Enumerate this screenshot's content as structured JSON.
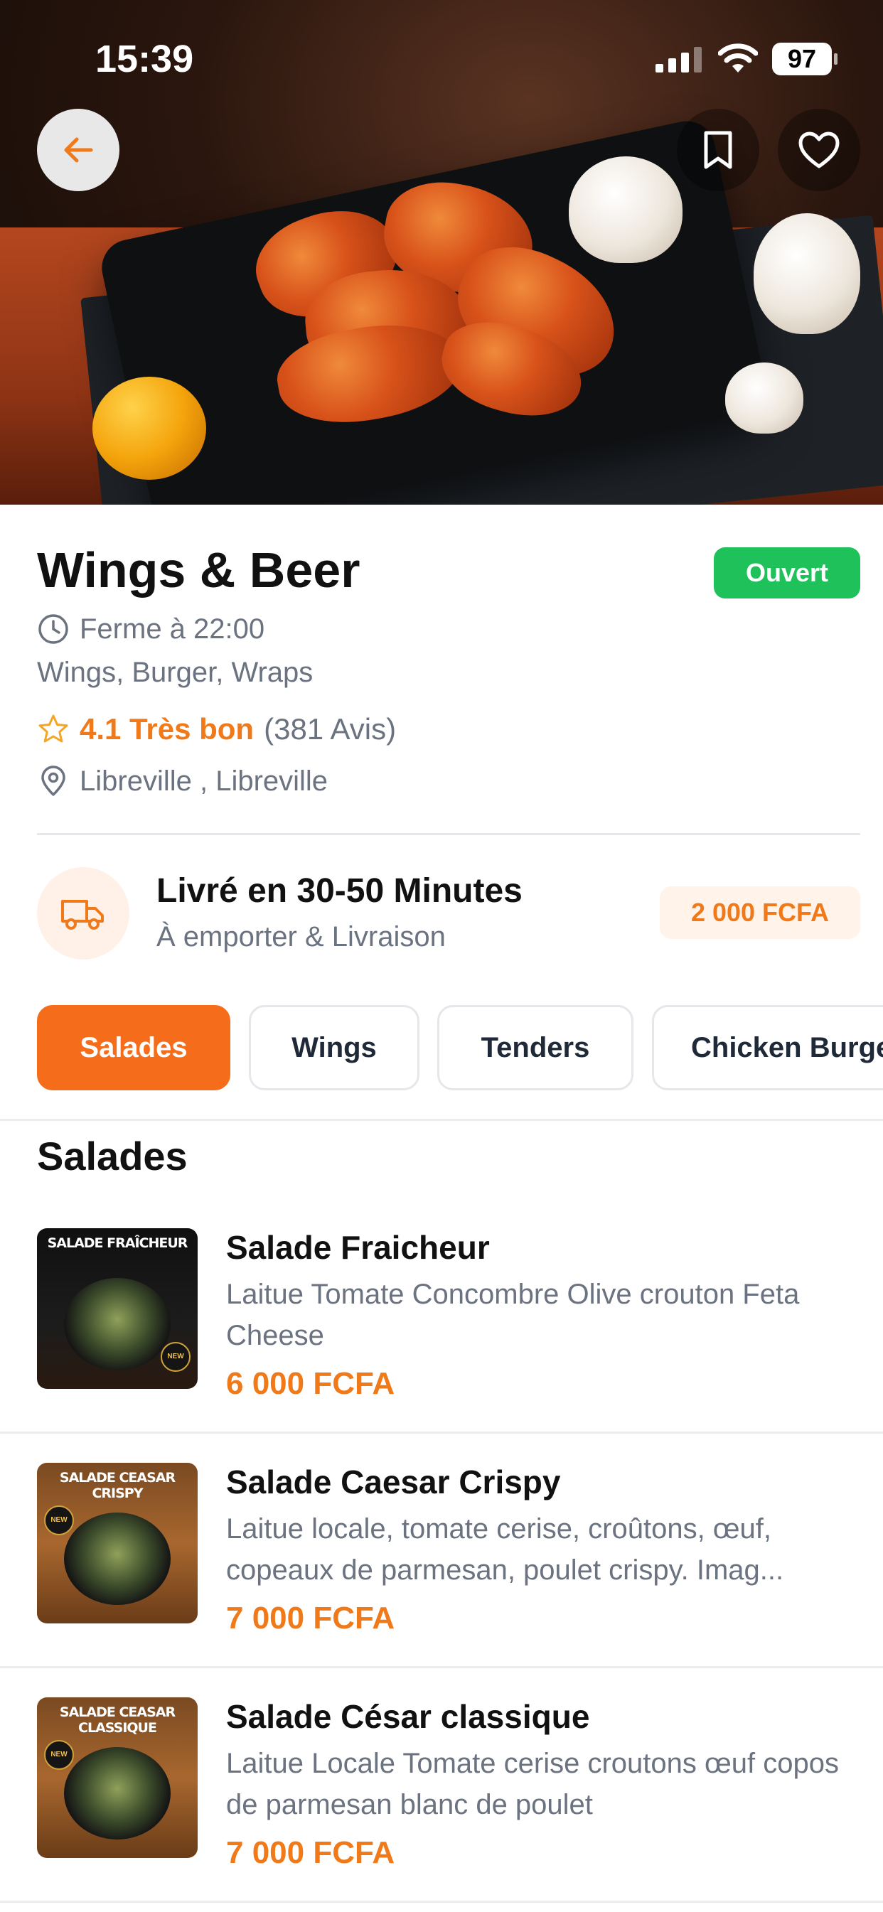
{
  "status_bar": {
    "time": "15:39",
    "battery": "97"
  },
  "restaurant": {
    "name": "Wings & Beer",
    "status": "Ouvert",
    "closing": "Ferme à 22:00",
    "cuisines": "Wings, Burger, Wraps",
    "rating": "4.1 Très bon",
    "reviews": "(381 Avis)",
    "location": "Libreville , Libreville"
  },
  "delivery": {
    "title": "Livré en 30-50 Minutes",
    "subtitle": "À emporter & Livraison",
    "fee": "2 000 FCFA"
  },
  "tabs": [
    {
      "label": "Salades"
    },
    {
      "label": "Wings"
    },
    {
      "label": "Tenders"
    },
    {
      "label": "Chicken Burgers"
    }
  ],
  "section": {
    "title": "Salades"
  },
  "items": [
    {
      "name": "Salade Fraicheur",
      "description": "Laitue Tomate Concombre Olive crouton Feta Cheese",
      "price": "6 000 FCFA",
      "thumb_label": "SALADE FRAÎCHEUR"
    },
    {
      "name": "Salade Caesar Crispy",
      "description": "Laitue locale, tomate cerise, croûtons, œuf, copeaux de parmesan, poulet crispy. Imag...",
      "price": "7 000 FCFA",
      "thumb_label": "SALADE CEASAR CRISPY"
    },
    {
      "name": "Salade César classique",
      "description": "Laitue Locale Tomate cerise croutons œuf copos de parmesan blanc de poulet",
      "price": "7 000 FCFA",
      "thumb_label": "SALADE CEASAR CLASSIQUE"
    }
  ],
  "colors": {
    "accent": "#f56d1a",
    "open_green": "#1ec15a",
    "muted_text": "#6b7280"
  },
  "icons": [
    "back-arrow-icon",
    "bookmark-icon",
    "heart-icon",
    "clock-icon",
    "star-icon",
    "location-pin-icon",
    "truck-icon"
  ]
}
